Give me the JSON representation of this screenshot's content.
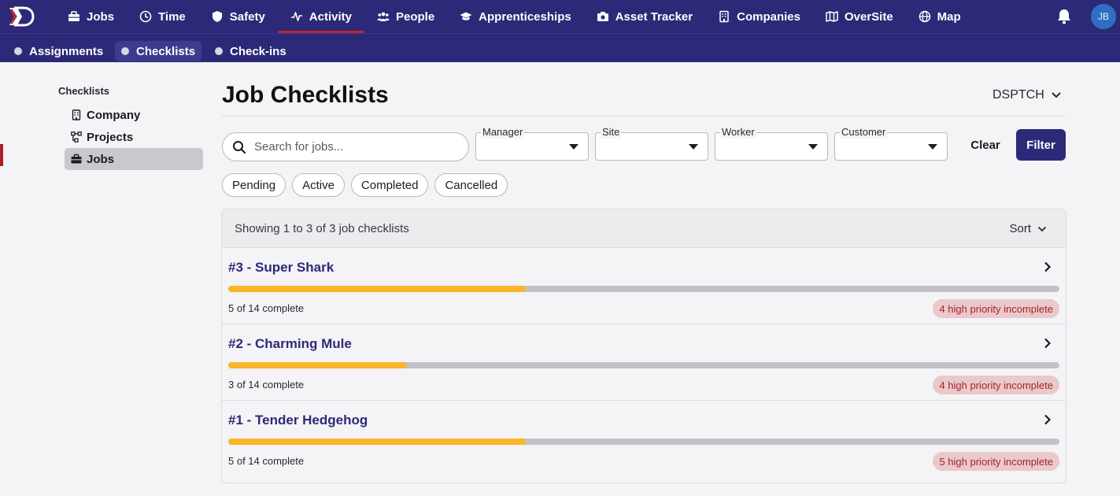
{
  "nav": {
    "items": [
      {
        "label": "Jobs",
        "icon": "briefcase-icon"
      },
      {
        "label": "Time",
        "icon": "clock-icon"
      },
      {
        "label": "Safety",
        "icon": "shield-icon"
      },
      {
        "label": "Activity",
        "icon": "activity-icon",
        "active": true
      },
      {
        "label": "People",
        "icon": "people-icon"
      },
      {
        "label": "Apprenticeships",
        "icon": "graduation-cap-icon"
      },
      {
        "label": "Asset Tracker",
        "icon": "camera-icon"
      },
      {
        "label": "Companies",
        "icon": "building-icon"
      },
      {
        "label": "OverSite",
        "icon": "map-icon"
      },
      {
        "label": "Map",
        "icon": "globe-icon"
      }
    ],
    "avatar_initials": "JB",
    "accent_color": "#c1272d",
    "bg_color": "#2c2a78"
  },
  "subnav": {
    "items": [
      {
        "label": "Assignments"
      },
      {
        "label": "Checklists",
        "active": true
      },
      {
        "label": "Check-ins"
      }
    ]
  },
  "sidebar": {
    "heading": "Checklists",
    "items": [
      {
        "label": "Company",
        "icon": "building-icon"
      },
      {
        "label": "Projects",
        "icon": "project-icon"
      },
      {
        "label": "Jobs",
        "icon": "briefcase-icon",
        "active": true
      }
    ]
  },
  "page": {
    "title": "Job Checklists",
    "org": "DSPTCH"
  },
  "filters": {
    "search_placeholder": "Search for jobs...",
    "dropdowns": [
      {
        "label": "Manager",
        "value": ""
      },
      {
        "label": "Site",
        "value": ""
      },
      {
        "label": "Worker",
        "value": ""
      },
      {
        "label": "Customer",
        "value": ""
      }
    ],
    "clear_label": "Clear",
    "filter_label": "Filter",
    "chips": [
      "Pending",
      "Active",
      "Completed",
      "Cancelled"
    ]
  },
  "list": {
    "summary": "Showing 1 to 3 of 3 job checklists",
    "sort_label": "Sort",
    "rows": [
      {
        "title": "#3 - Super Shark",
        "completed": 5,
        "total": 14,
        "count_text": "5 of 14 complete",
        "badge": "4 high priority incomplete"
      },
      {
        "title": "#2 - Charming Mule",
        "completed": 3,
        "total": 14,
        "count_text": "3 of 14 complete",
        "badge": "4 high priority incomplete"
      },
      {
        "title": "#1 - Tender Hedgehog",
        "completed": 5,
        "total": 14,
        "count_text": "5 of 14 complete",
        "badge": "5 high priority incomplete"
      }
    ]
  },
  "colors": {
    "progress": "#fbb528",
    "badge_bg": "#eac9cb",
    "badge_text": "#a5232a"
  }
}
